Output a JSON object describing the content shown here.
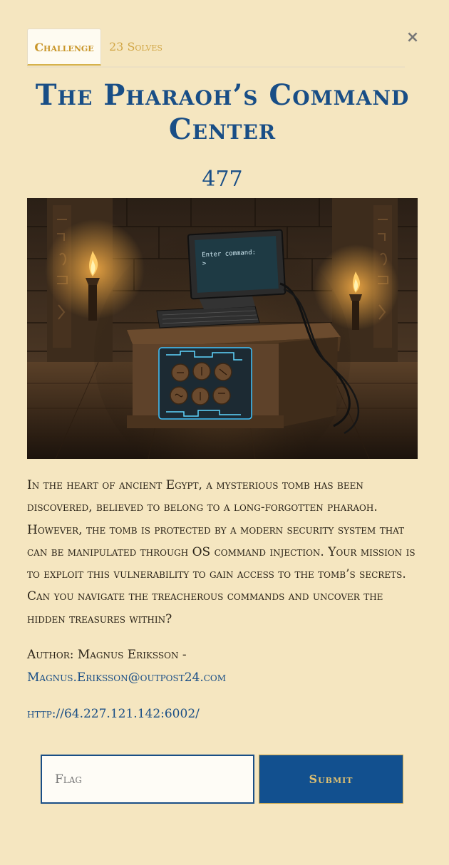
{
  "tabs": {
    "challenge_label": "Challenge",
    "solves_label": "23 Solves"
  },
  "close_icon": "close-icon",
  "close_glyph": "×",
  "challenge": {
    "title": "The Pharaoh’s Command Center",
    "points": "477",
    "image_icon": "tomb-terminal-illustration",
    "image_screen_text": "Enter command:",
    "image_prompt": ">",
    "description": "In the heart of ancient Egypt, a mysterious tomb has been discovered, believed to belong to a long-forgotten pharaoh. However, the tomb is protected by a modern security system that can be manipulated through OS command injection. Your mission is to exploit this vulnerability to gain access to the tomb’s secrets. Can you navigate the treacherous commands and uncover the hidden treasures within?",
    "author_prefix": "Author: Magnus Eriksson -",
    "author_email": "Magnus.Eriksson@outpost24.com",
    "url": "http://64.227.121.142:6002/"
  },
  "form": {
    "flag_placeholder": "Flag",
    "flag_value": "",
    "submit_label": "Submit"
  },
  "colors": {
    "background": "#f5e6c0",
    "title": "#194e86",
    "accent_gold": "#d1a645",
    "button": "#12508f"
  }
}
